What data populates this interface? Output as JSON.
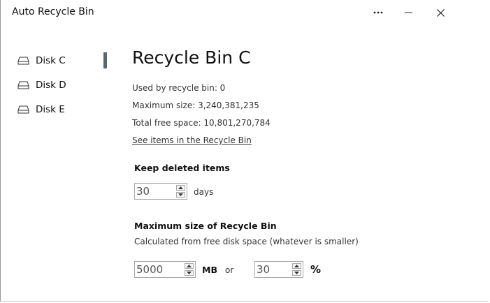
{
  "window": {
    "title": "Auto Recycle Bin"
  },
  "titlebar": {
    "more": "more-icon",
    "minimize": "minimize-icon",
    "close": "close-icon"
  },
  "sidebar": {
    "items": [
      {
        "label": "Disk C",
        "icon": "drive-icon",
        "selected": true
      },
      {
        "label": "Disk D",
        "icon": "drive-icon",
        "selected": false
      },
      {
        "label": "Disk E",
        "icon": "drive-icon",
        "selected": false
      }
    ]
  },
  "main": {
    "title": "Recycle Bin C",
    "used": "Used by recycle bin: 0",
    "max_size": "Maximum size: 3,240,381,235",
    "free_space": "Total free space: 10,801,270,784",
    "see_items_link": "See items in the Recycle Bin",
    "keep": {
      "title": "Keep deleted items",
      "value": "30",
      "unit": "days"
    },
    "max": {
      "title": "Maximum size of Recycle Bin",
      "subtitle": "Calculated from free disk space (whatever is smaller)",
      "mb_value": "5000",
      "mb_unit": "MB",
      "or_label": "or",
      "pct_value": "30",
      "pct_unit": "%"
    }
  },
  "colors": {
    "selection_indicator": "#5a6570"
  }
}
